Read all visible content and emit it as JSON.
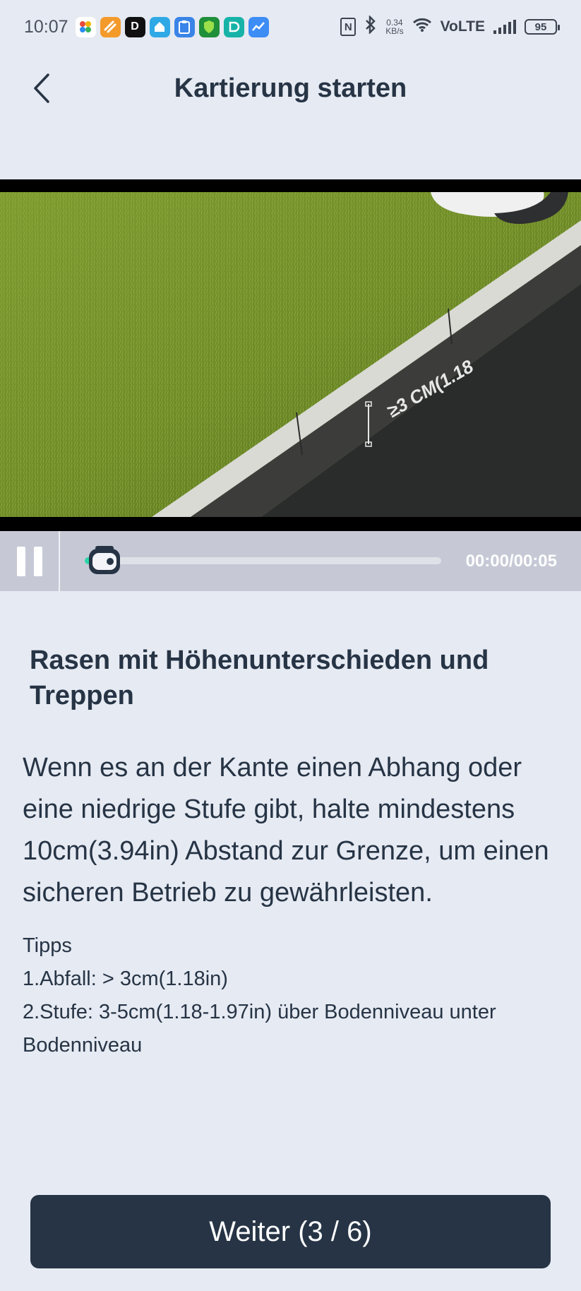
{
  "status_bar": {
    "time": "10:07",
    "speed_value": "0.34",
    "speed_unit": "KB/s",
    "network": "VoLTE",
    "battery": "95",
    "app_icons": [
      "photos-icon",
      "notes-icon",
      "dict-icon",
      "home-icon",
      "clipboard-icon",
      "shield-icon",
      "dashlane-icon",
      "stocks-icon"
    ]
  },
  "header": {
    "title": "Kartierung starten"
  },
  "video": {
    "scene_label": "≥3 CM(1.18",
    "time": "00:00/00:05",
    "progress": 0.0
  },
  "content": {
    "heading": "Rasen mit Höhenunterschieden und Treppen",
    "body": "Wenn es an der Kante einen Abhang oder eine niedrige Stufe gibt, halte mindestens 10cm(3.94in) Abstand zur Grenze, um einen sicheren Betrieb zu gewährleisten.",
    "tips_title": "Tipps",
    "tips": [
      "1.Abfall: > 3cm(1.18in)",
      "2.Stufe: 3-5cm(1.18-1.97in) über Bodenniveau unter Bodenniveau"
    ]
  },
  "footer": {
    "next_label": "Weiter (3 / 6)"
  },
  "colors": {
    "background": "#e6eaf2",
    "primary": "#263445",
    "controls_bar": "#c6c9d5",
    "progress_accent": "#2dd4a8"
  }
}
